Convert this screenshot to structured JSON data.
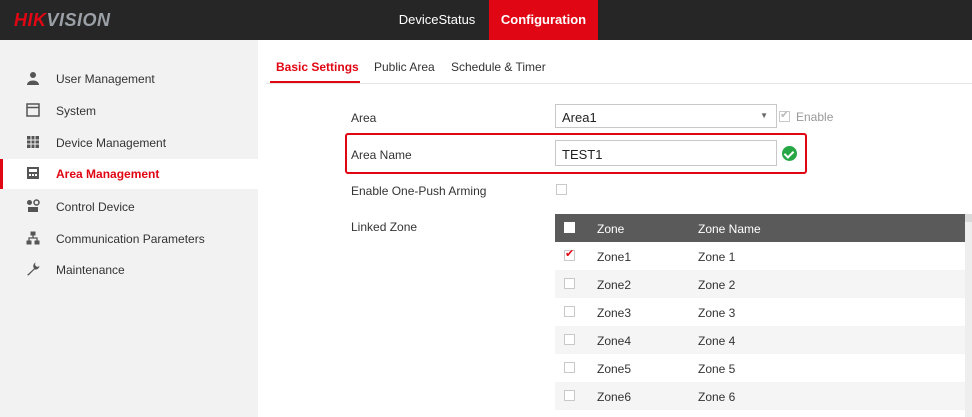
{
  "brand": {
    "logo_hik": "HIK",
    "logo_vision": "VISION"
  },
  "topnav": {
    "device_status": "DeviceStatus",
    "configuration": "Configuration"
  },
  "sidebar": {
    "items": [
      {
        "label": "User Management",
        "icon": "user-icon"
      },
      {
        "label": "System",
        "icon": "system-window-icon"
      },
      {
        "label": "Device Management",
        "icon": "device-grid-icon"
      },
      {
        "label": "Area Management",
        "icon": "area-keypad-icon",
        "active": true
      },
      {
        "label": "Control Device",
        "icon": "control-device-icon"
      },
      {
        "label": "Communication Parameters",
        "icon": "network-icon"
      },
      {
        "label": "Maintenance",
        "icon": "wrench-icon"
      }
    ]
  },
  "tabs": {
    "basic": "Basic Settings",
    "public": "Public Area",
    "schedule": "Schedule & Timer"
  },
  "form": {
    "area_label": "Area",
    "area_value": "Area1",
    "enable_label": "Enable",
    "area_name_label": "Area Name",
    "area_name_value": "TEST1",
    "one_push_label": "Enable One-Push Arming",
    "linked_zone_label": "Linked Zone"
  },
  "zone_table": {
    "headers": {
      "zone": "Zone",
      "zone_name": "Zone Name"
    },
    "rows": [
      {
        "zone": "Zone1",
        "name": "Zone 1",
        "checked": true
      },
      {
        "zone": "Zone2",
        "name": "Zone 2",
        "checked": false
      },
      {
        "zone": "Zone3",
        "name": "Zone 3",
        "checked": false
      },
      {
        "zone": "Zone4",
        "name": "Zone 4",
        "checked": false
      },
      {
        "zone": "Zone5",
        "name": "Zone 5",
        "checked": false
      },
      {
        "zone": "Zone6",
        "name": "Zone 6",
        "checked": false
      }
    ]
  },
  "colors": {
    "accent": "#e10613",
    "topbar": "#262626",
    "sidebar": "#f2f2f2",
    "valid": "#27a645"
  }
}
